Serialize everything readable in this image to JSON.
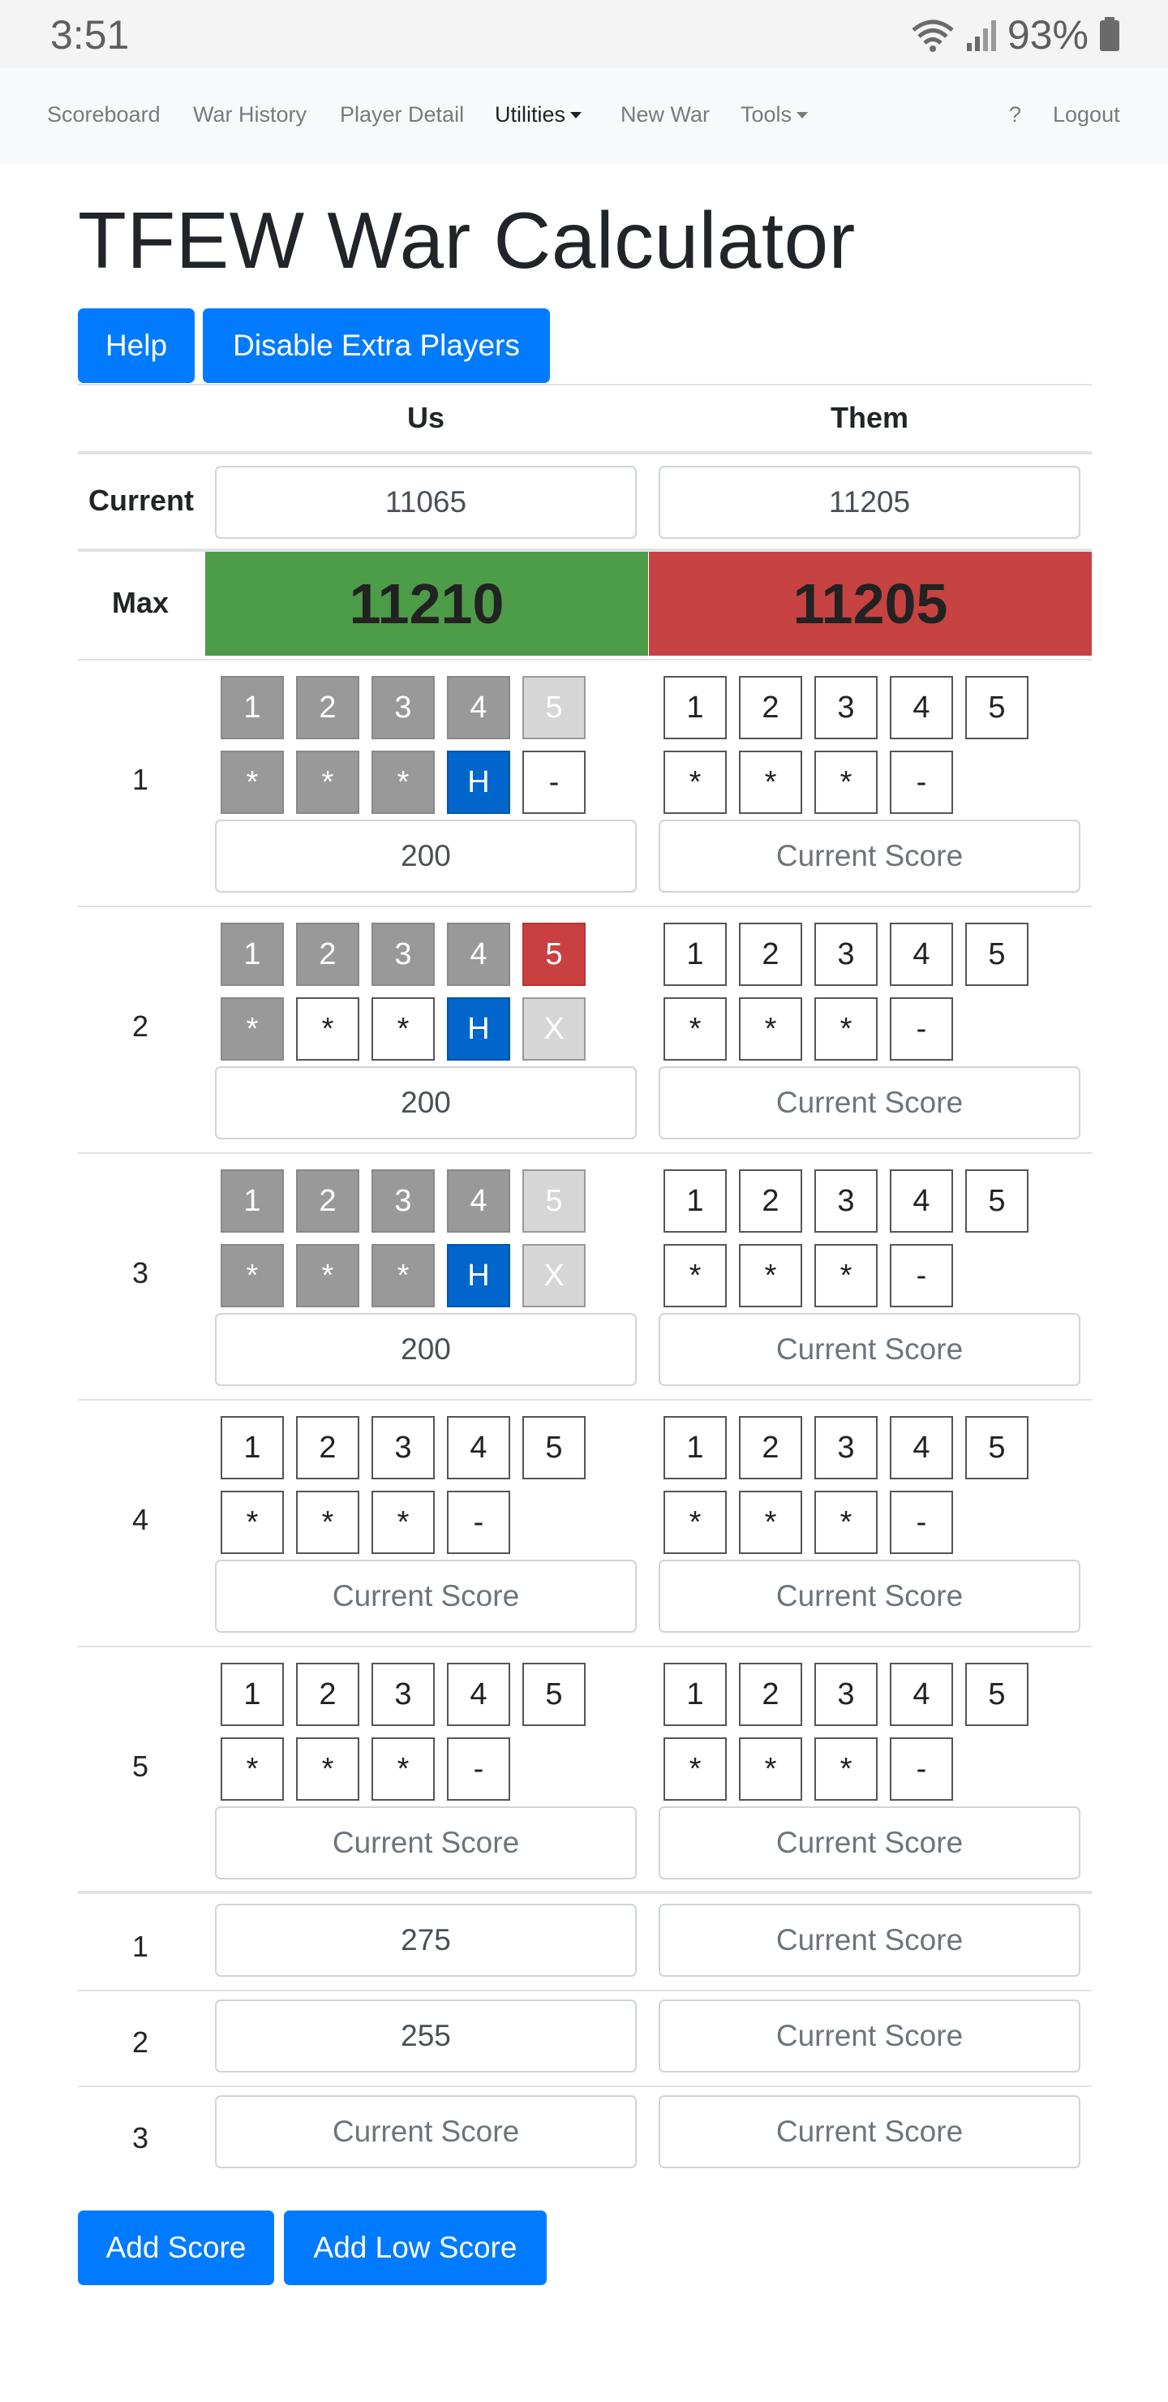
{
  "status_bar": {
    "time": "3:51",
    "battery": "93%"
  },
  "nav": {
    "items": [
      "Scoreboard",
      "War History",
      "Player Detail",
      "Utilities",
      "New War",
      "Tools"
    ],
    "help": "?",
    "logout": "Logout"
  },
  "page": {
    "title": "TFEW War Calculator",
    "help_button": "Help",
    "disable_button": "Disable Extra Players"
  },
  "table": {
    "col_us": "Us",
    "col_them": "Them",
    "current_label": "Current",
    "current_us": "11065",
    "current_them": "11205",
    "max_label": "Max",
    "max_us": "11210",
    "max_them": "11205"
  },
  "score_placeholder": "Current Score",
  "rows": [
    {
      "label": "1",
      "us": {
        "nums": [
          [
            "1",
            "g"
          ],
          [
            "2",
            "g"
          ],
          [
            "3",
            "g"
          ],
          [
            "4",
            "g"
          ],
          [
            "5",
            "lg"
          ]
        ],
        "marks": [
          [
            "*",
            "g"
          ],
          [
            "*",
            "g"
          ],
          [
            "*",
            "g"
          ],
          [
            "H",
            "b"
          ],
          [
            "-",
            ""
          ]
        ],
        "score": "200"
      },
      "them": {
        "nums": [
          [
            "1",
            ""
          ],
          [
            "2",
            ""
          ],
          [
            "3",
            ""
          ],
          [
            "4",
            ""
          ],
          [
            "5",
            ""
          ]
        ],
        "marks": [
          [
            "*",
            ""
          ],
          [
            "*",
            ""
          ],
          [
            "*",
            ""
          ],
          [
            "-",
            ""
          ]
        ],
        "score": ""
      }
    },
    {
      "label": "2",
      "us": {
        "nums": [
          [
            "1",
            "g"
          ],
          [
            "2",
            "g"
          ],
          [
            "3",
            "g"
          ],
          [
            "4",
            "g"
          ],
          [
            "5",
            "r"
          ]
        ],
        "marks": [
          [
            "*",
            "g"
          ],
          [
            "*",
            ""
          ],
          [
            "*",
            ""
          ],
          [
            "H",
            "b"
          ],
          [
            "X",
            "lg"
          ]
        ],
        "score": "200"
      },
      "them": {
        "nums": [
          [
            "1",
            ""
          ],
          [
            "2",
            ""
          ],
          [
            "3",
            ""
          ],
          [
            "4",
            ""
          ],
          [
            "5",
            ""
          ]
        ],
        "marks": [
          [
            "*",
            ""
          ],
          [
            "*",
            ""
          ],
          [
            "*",
            ""
          ],
          [
            "-",
            ""
          ]
        ],
        "score": ""
      }
    },
    {
      "label": "3",
      "us": {
        "nums": [
          [
            "1",
            "g"
          ],
          [
            "2",
            "g"
          ],
          [
            "3",
            "g"
          ],
          [
            "4",
            "g"
          ],
          [
            "5",
            "lg"
          ]
        ],
        "marks": [
          [
            "*",
            "g"
          ],
          [
            "*",
            "g"
          ],
          [
            "*",
            "g"
          ],
          [
            "H",
            "b"
          ],
          [
            "X",
            "lg"
          ]
        ],
        "score": "200"
      },
      "them": {
        "nums": [
          [
            "1",
            ""
          ],
          [
            "2",
            ""
          ],
          [
            "3",
            ""
          ],
          [
            "4",
            ""
          ],
          [
            "5",
            ""
          ]
        ],
        "marks": [
          [
            "*",
            ""
          ],
          [
            "*",
            ""
          ],
          [
            "*",
            ""
          ],
          [
            "-",
            ""
          ]
        ],
        "score": ""
      }
    },
    {
      "label": "4",
      "us": {
        "nums": [
          [
            "1",
            ""
          ],
          [
            "2",
            ""
          ],
          [
            "3",
            ""
          ],
          [
            "4",
            ""
          ],
          [
            "5",
            ""
          ]
        ],
        "marks": [
          [
            "*",
            ""
          ],
          [
            "*",
            ""
          ],
          [
            "*",
            ""
          ],
          [
            "-",
            ""
          ]
        ],
        "score": ""
      },
      "them": {
        "nums": [
          [
            "1",
            ""
          ],
          [
            "2",
            ""
          ],
          [
            "3",
            ""
          ],
          [
            "4",
            ""
          ],
          [
            "5",
            ""
          ]
        ],
        "marks": [
          [
            "*",
            ""
          ],
          [
            "*",
            ""
          ],
          [
            "*",
            ""
          ],
          [
            "-",
            ""
          ]
        ],
        "score": ""
      }
    },
    {
      "label": "5",
      "us": {
        "nums": [
          [
            "1",
            ""
          ],
          [
            "2",
            ""
          ],
          [
            "3",
            ""
          ],
          [
            "4",
            ""
          ],
          [
            "5",
            ""
          ]
        ],
        "marks": [
          [
            "*",
            ""
          ],
          [
            "*",
            ""
          ],
          [
            "*",
            ""
          ],
          [
            "-",
            ""
          ]
        ],
        "score": ""
      },
      "them": {
        "nums": [
          [
            "1",
            ""
          ],
          [
            "2",
            ""
          ],
          [
            "3",
            ""
          ],
          [
            "4",
            ""
          ],
          [
            "5",
            ""
          ]
        ],
        "marks": [
          [
            "*",
            ""
          ],
          [
            "*",
            ""
          ],
          [
            "*",
            ""
          ],
          [
            "-",
            ""
          ]
        ],
        "score": ""
      }
    }
  ],
  "extra_rows": [
    {
      "label": "1",
      "us": "275",
      "them": ""
    },
    {
      "label": "2",
      "us": "255",
      "them": ""
    },
    {
      "label": "3",
      "us": "",
      "them": ""
    }
  ],
  "bottom": {
    "add_score": "Add Score",
    "add_low_score": "Add Low Score"
  },
  "colors": {
    "primary": "#007bff",
    "max_us_bg": "#4d9c48",
    "max_them_bg": "#c64342",
    "selected_blue": "#0066cc",
    "done_gray": "#999999"
  }
}
